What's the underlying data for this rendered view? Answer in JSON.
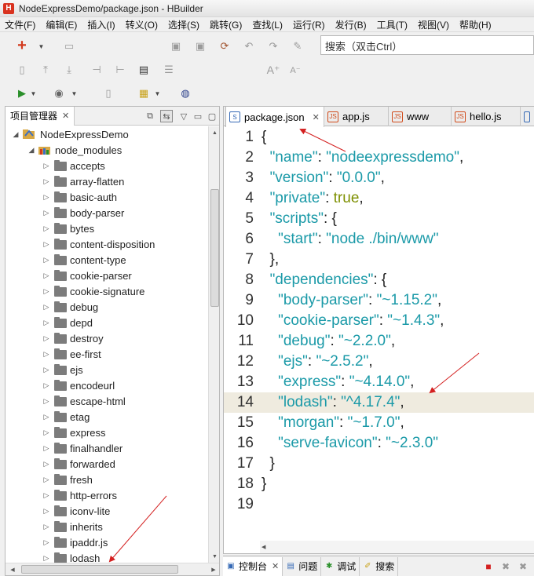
{
  "window": {
    "title": "NodeExpressDemo/package.json  -  HBuilder",
    "app_icon": "H"
  },
  "menu": [
    "文件(F)",
    "编辑(E)",
    "插入(I)",
    "转义(O)",
    "选择(S)",
    "跳转(G)",
    "查找(L)",
    "运行(R)",
    "发行(B)",
    "工具(T)",
    "视图(V)",
    "帮助(H)"
  ],
  "toolbar": {
    "search_placeholder": "搜索（双击Ctrl）"
  },
  "explorer": {
    "tab_label": "项目管理器",
    "project": "NodeExpressDemo",
    "node_modules": "node_modules",
    "folders": [
      "accepts",
      "array-flatten",
      "basic-auth",
      "body-parser",
      "bytes",
      "content-disposition",
      "content-type",
      "cookie-parser",
      "cookie-signature",
      "debug",
      "depd",
      "destroy",
      "ee-first",
      "ejs",
      "encodeurl",
      "escape-html",
      "etag",
      "express",
      "finalhandler",
      "forwarded",
      "fresh",
      "http-errors",
      "iconv-lite",
      "inherits",
      "ipaddr.js",
      "lodash"
    ]
  },
  "editor": {
    "tabs": [
      {
        "label": "package.json",
        "icon": "S",
        "active": true
      },
      {
        "label": "app.js",
        "icon": "JS",
        "active": false
      },
      {
        "label": "www",
        "icon": "JS",
        "active": false
      },
      {
        "label": "hello.js",
        "icon": "JS",
        "active": false
      }
    ],
    "current_line": 14,
    "lines": [
      [
        [
          "punct",
          "{"
        ]
      ],
      [
        [
          "punct",
          "  "
        ],
        [
          "key",
          "\"name\""
        ],
        [
          "punct",
          ": "
        ],
        [
          "str",
          "\"nodeexpressdemo\""
        ],
        [
          "punct",
          ","
        ]
      ],
      [
        [
          "punct",
          "  "
        ],
        [
          "key",
          "\"version\""
        ],
        [
          "punct",
          ": "
        ],
        [
          "str",
          "\"0.0.0\""
        ],
        [
          "punct",
          ","
        ]
      ],
      [
        [
          "punct",
          "  "
        ],
        [
          "key",
          "\"private\""
        ],
        [
          "punct",
          ": "
        ],
        [
          "kw",
          "true"
        ],
        [
          "punct",
          ","
        ]
      ],
      [
        [
          "punct",
          "  "
        ],
        [
          "key",
          "\"scripts\""
        ],
        [
          "punct",
          ": {"
        ]
      ],
      [
        [
          "punct",
          "    "
        ],
        [
          "key",
          "\"start\""
        ],
        [
          "punct",
          ": "
        ],
        [
          "str",
          "\"node ./bin/www\""
        ]
      ],
      [
        [
          "punct",
          "  },"
        ]
      ],
      [
        [
          "punct",
          "  "
        ],
        [
          "key",
          "\"dependencies\""
        ],
        [
          "punct",
          ": {"
        ]
      ],
      [
        [
          "punct",
          "    "
        ],
        [
          "key",
          "\"body-parser\""
        ],
        [
          "punct",
          ": "
        ],
        [
          "str",
          "\"~1.15.2\""
        ],
        [
          "punct",
          ","
        ]
      ],
      [
        [
          "punct",
          "    "
        ],
        [
          "key",
          "\"cookie-parser\""
        ],
        [
          "punct",
          ": "
        ],
        [
          "str",
          "\"~1.4.3\""
        ],
        [
          "punct",
          ","
        ]
      ],
      [
        [
          "punct",
          "    "
        ],
        [
          "key",
          "\"debug\""
        ],
        [
          "punct",
          ": "
        ],
        [
          "str",
          "\"~2.2.0\""
        ],
        [
          "punct",
          ","
        ]
      ],
      [
        [
          "punct",
          "    "
        ],
        [
          "key",
          "\"ejs\""
        ],
        [
          "punct",
          ": "
        ],
        [
          "str",
          "\"~2.5.2\""
        ],
        [
          "punct",
          ","
        ]
      ],
      [
        [
          "punct",
          "    "
        ],
        [
          "key",
          "\"express\""
        ],
        [
          "punct",
          ": "
        ],
        [
          "str",
          "\"~4.14.0\""
        ],
        [
          "punct",
          ","
        ]
      ],
      [
        [
          "punct",
          "    "
        ],
        [
          "key",
          "\"lodash\""
        ],
        [
          "punct",
          ": "
        ],
        [
          "str",
          "\"^4.17.4\""
        ],
        [
          "punct",
          ","
        ]
      ],
      [
        [
          "punct",
          "    "
        ],
        [
          "key",
          "\"morgan\""
        ],
        [
          "punct",
          ": "
        ],
        [
          "str",
          "\"~1.7.0\""
        ],
        [
          "punct",
          ","
        ]
      ],
      [
        [
          "punct",
          "    "
        ],
        [
          "key",
          "\"serve-favicon\""
        ],
        [
          "punct",
          ": "
        ],
        [
          "str",
          "\"~2.3.0\""
        ]
      ],
      [
        [
          "punct",
          "  }"
        ]
      ],
      [
        [
          "punct",
          "}"
        ]
      ],
      []
    ]
  },
  "bottom_panel": {
    "tabs": [
      "控制台",
      "问题",
      "调试",
      "搜索"
    ]
  },
  "colors": {
    "key": "#1b9aa8",
    "keyword": "#7d8f00",
    "current_line": "#efebdf",
    "annotation": "#d42020"
  }
}
